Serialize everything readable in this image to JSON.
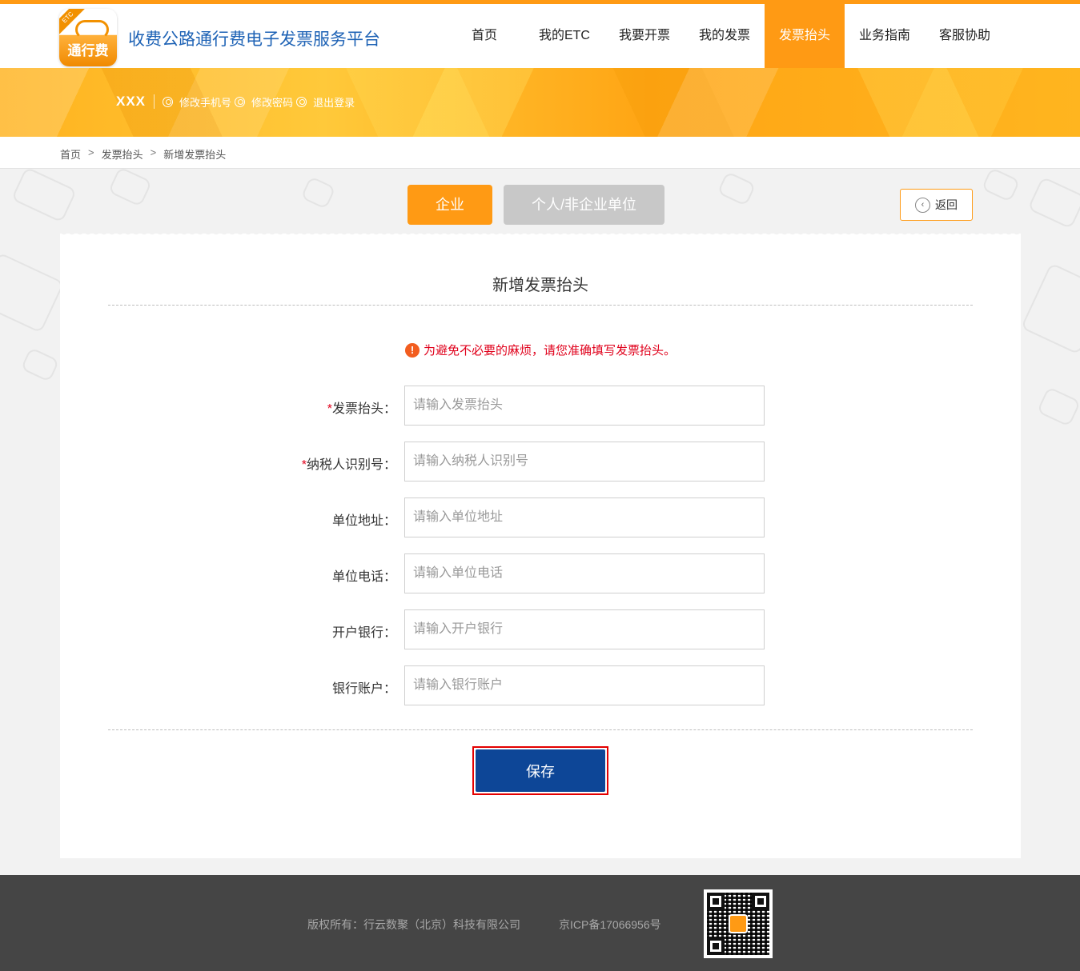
{
  "header": {
    "logo_text": "通行费",
    "logo_ribbon": "ETC",
    "site_title": "收费公路通行费电子发票服务平台",
    "nav": [
      {
        "label": "首页"
      },
      {
        "label": "我的ETC"
      },
      {
        "label": "我要开票"
      },
      {
        "label": "我的发票"
      },
      {
        "label": "发票抬头",
        "active": true
      },
      {
        "label": "业务指南"
      },
      {
        "label": "客服协助"
      }
    ]
  },
  "user_bar": {
    "username": "XXX",
    "change_phone": "修改手机号",
    "change_password": "修改密码",
    "logout": "退出登录"
  },
  "breadcrumb": {
    "items": [
      "首页",
      "发票抬头",
      "新增发票抬头"
    ],
    "separator": ">"
  },
  "tabs": {
    "company": "企业",
    "personal": "个人/非企业单位",
    "active": "企业"
  },
  "back_label": "返回",
  "form": {
    "title": "新增发票抬头",
    "notice": "为避免不必要的麻烦，请您准确填写发票抬头。",
    "notice_icon": "!",
    "fields": [
      {
        "label": "发票抬头：",
        "required": true,
        "placeholder": "请输入发票抬头",
        "value": ""
      },
      {
        "label": "纳税人识别号：",
        "required": true,
        "placeholder": "请输入纳税人识别号",
        "value": ""
      },
      {
        "label": "单位地址：",
        "required": false,
        "placeholder": "请输入单位地址",
        "value": ""
      },
      {
        "label": "单位电话：",
        "required": false,
        "placeholder": "请输入单位电话",
        "value": ""
      },
      {
        "label": "开户银行：",
        "required": false,
        "placeholder": "请输入开户银行",
        "value": ""
      },
      {
        "label": "银行账户：",
        "required": false,
        "placeholder": "请输入银行账户",
        "value": ""
      }
    ],
    "save_label": "保存"
  },
  "footer": {
    "copyright": "版权所有：行云数聚（北京）科技有限公司",
    "icp": "京ICP备17066956号"
  },
  "colors": {
    "accent": "#ff9a14",
    "brand_blue": "#1d62b5",
    "save_button": "#0d4697",
    "highlight_border": "#e30000",
    "required": "#e0001b",
    "footer_bg": "#454545"
  }
}
